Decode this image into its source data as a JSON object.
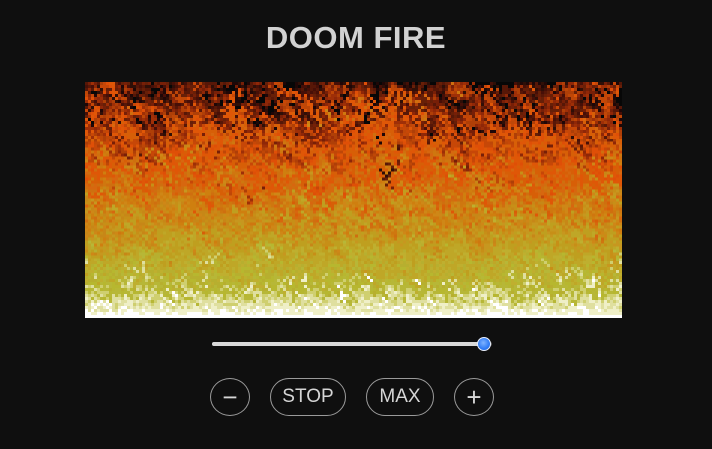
{
  "title": "DOOM FIRE",
  "intensity": {
    "value_fraction": 0.97
  },
  "controls": {
    "decrease_label": "−",
    "stop_label": "STOP",
    "max_label": "MAX",
    "increase_label": "+"
  },
  "colors": {
    "background": "#0f0f0f",
    "fire_palette": [
      "#070707",
      "#1f0707",
      "#2f0f07",
      "#470f07",
      "#571707",
      "#671f07",
      "#771f07",
      "#8f2707",
      "#9f2f07",
      "#af3f07",
      "#bf4707",
      "#c74707",
      "#df4f07",
      "#df5707",
      "#df5707",
      "#d75f07",
      "#d75f07",
      "#d7670f",
      "#cf6f0f",
      "#cf770f",
      "#cf7f0f",
      "#cf8717",
      "#c78717",
      "#c78f17",
      "#c7971f",
      "#bf9f1f",
      "#bf9f1f",
      "#bfa727",
      "#bfa727",
      "#bfaf2f",
      "#b7af2f",
      "#b7b72f",
      "#b7b737",
      "#cfcf6f",
      "#dfdf9f",
      "#efefc7",
      "#ffffff"
    ],
    "slider_thumb": "#2f7bf5"
  }
}
